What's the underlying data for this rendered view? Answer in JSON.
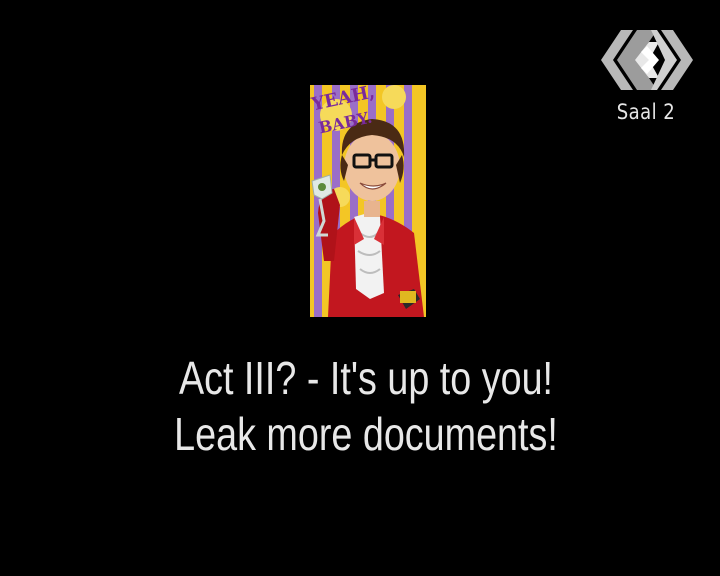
{
  "broadcast": {
    "room": "Saal 2",
    "logo_icon": "ccc-congress-logo"
  },
  "poster": {
    "tagline": "YEAH, BABY.",
    "badge": "AUSTIN POWERS",
    "colors": {
      "stripe_yellow": "#f3c625",
      "stripe_purple": "#9a6ec8",
      "suit_red": "#c2171f",
      "tagline_purple": "#7a2a9c"
    }
  },
  "caption": {
    "line1": "Act III? - It's up to you!",
    "line2": "Leak more documents!"
  }
}
